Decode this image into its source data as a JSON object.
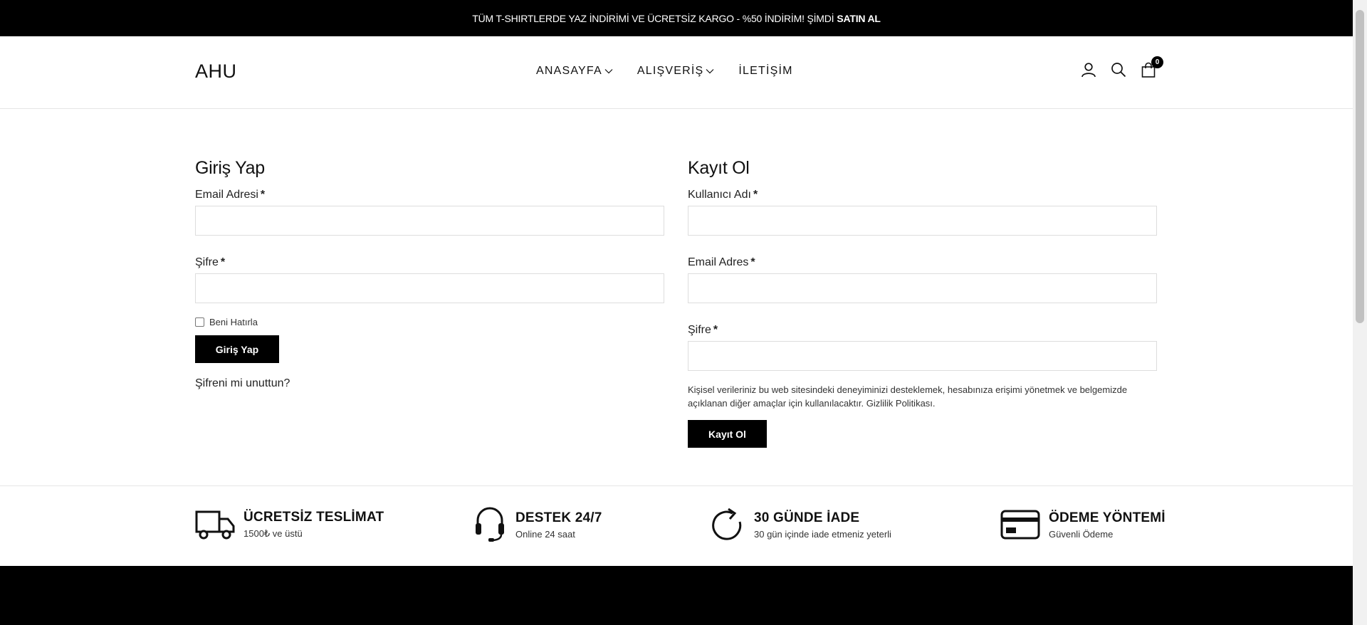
{
  "promo": {
    "text": "TÜM T-SHIRTLERDE YAZ İNDİRİMİ VE ÜCRETSİZ KARGO - %50 İNDİRİM! ŞİMDİ SATIN AL",
    "cta": "SATIN AL"
  },
  "header": {
    "logo": "AHU",
    "nav": [
      {
        "label": "ANASAYFA",
        "icon": "chevron-down-icon"
      },
      {
        "label": "ALIŞVERİŞ",
        "icon": "chevron-down-icon"
      },
      {
        "label": "İLETİŞİM"
      }
    ],
    "cart_count": "0",
    "icons": [
      "user-icon",
      "search-icon",
      "cart-icon"
    ]
  },
  "login": {
    "title": "Giriş Yap",
    "email_label": "Email Adresi",
    "password_label": "Şifre",
    "required_mark": "*",
    "remember_label": "Beni Hatırla",
    "submit_label": "Giriş Yap",
    "forgot_label": "Şifreni mi unuttun?"
  },
  "register": {
    "title": "Kayıt Ol",
    "username_label": "Kullanıcı Adı",
    "email_label": "Email Adres",
    "password_label": "Şifre",
    "required_mark": "*",
    "privacy_text": "Kişisel verileriniz bu web sitesindeki deneyiminizi desteklemek, hesabınıza erişimi yönetmek ve belgemizde açıklanan diğer amaçlar için kullanılacaktır. Gizlilik Politikası.",
    "submit_label": "Kayıt Ol"
  },
  "features": [
    {
      "icon": "truck-icon",
      "title": "ÜCRETSİZ TESLİMAT",
      "subtitle": "1500₺ ve üstü"
    },
    {
      "icon": "headset-icon",
      "title": "DESTEK 24/7",
      "subtitle": "Online 24 saat"
    },
    {
      "icon": "refresh-icon",
      "title": "30 GÜNDE İADE",
      "subtitle": "30 gün içinde iade etmeniz yeterli"
    },
    {
      "icon": "credit-card-icon",
      "title": "ÖDEME YÖNTEMİ",
      "subtitle": "Güvenli Ödeme"
    }
  ]
}
